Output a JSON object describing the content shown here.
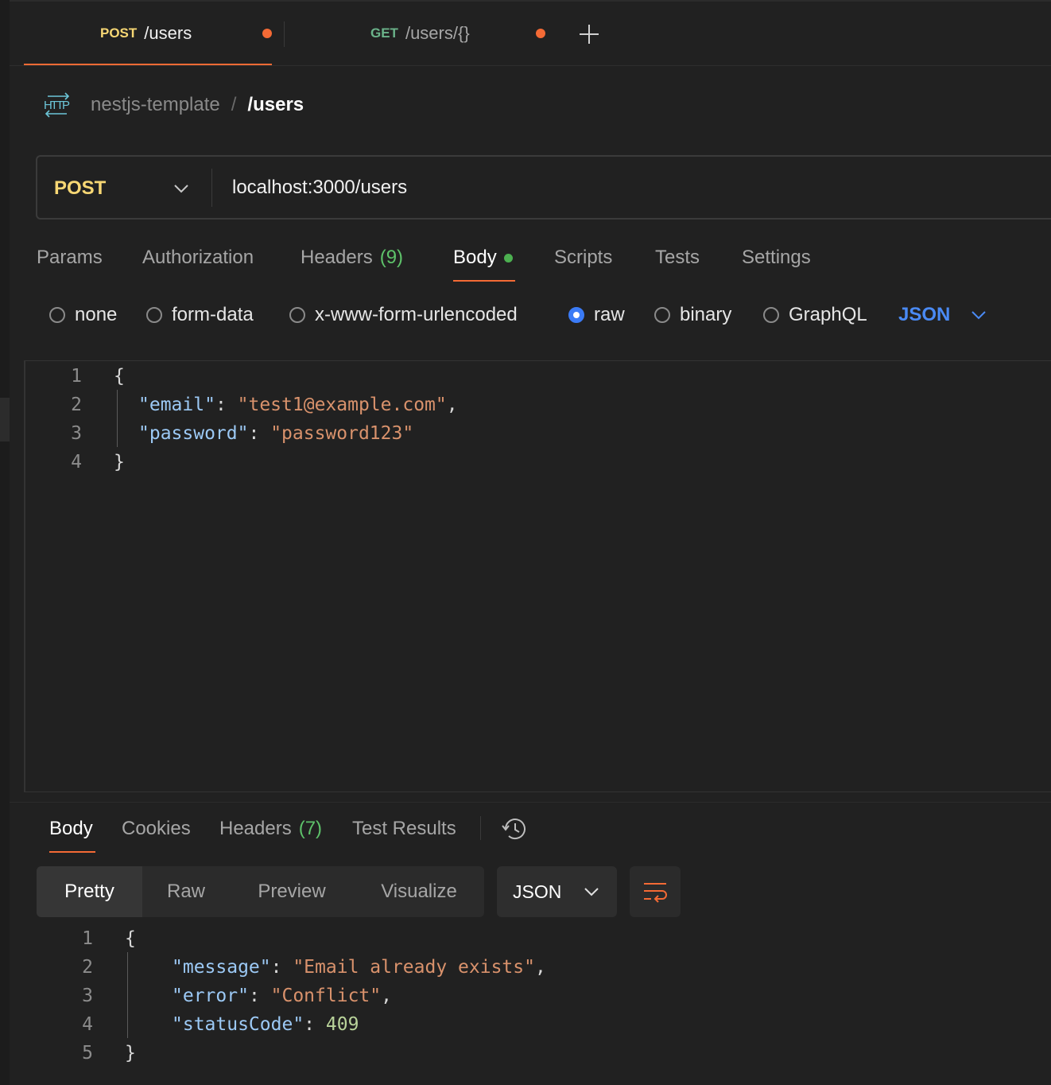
{
  "tabs": [
    {
      "method": "POST",
      "path": "/users",
      "method_color": "#f7d774",
      "unsaved": true,
      "active": true
    },
    {
      "method": "GET",
      "path": "/users/{}",
      "method_color": "#6bb38a",
      "unsaved": true,
      "active": false
    }
  ],
  "breadcrumb": {
    "collection": "nestjs-template",
    "separator": "/",
    "request": "/users"
  },
  "request": {
    "method": "POST",
    "url": "localhost:3000/users"
  },
  "request_tabs": {
    "params": "Params",
    "authorization": "Authorization",
    "headers": "Headers",
    "headers_count": "(9)",
    "body": "Body",
    "scripts": "Scripts",
    "tests": "Tests",
    "settings": "Settings"
  },
  "body_modes": {
    "none": "none",
    "form_data": "form-data",
    "urlencoded": "x-www-form-urlencoded",
    "raw": "raw",
    "binary": "binary",
    "graphql": "GraphQL",
    "selected": "raw",
    "language": "JSON"
  },
  "request_body": {
    "line_numbers": [
      "1",
      "2",
      "3",
      "4"
    ],
    "open_brace": "{",
    "close_brace": "}",
    "email_key": "\"email\"",
    "email_value": "\"test1@example.com\"",
    "password_key": "\"password\"",
    "password_value": "\"password123\""
  },
  "response_tabs": {
    "body": "Body",
    "cookies": "Cookies",
    "headers": "Headers",
    "headers_count": "(7)",
    "test_results": "Test Results"
  },
  "response_view": {
    "pretty": "Pretty",
    "raw": "Raw",
    "preview": "Preview",
    "visualize": "Visualize",
    "format": "JSON"
  },
  "response_body": {
    "line_numbers": [
      "1",
      "2",
      "3",
      "4",
      "5"
    ],
    "open_brace": "{",
    "close_brace": "}",
    "message_key": "\"message\"",
    "message_value": "\"Email already exists\"",
    "error_key": "\"error\"",
    "error_value": "\"Conflict\"",
    "status_key": "\"statusCode\"",
    "status_value": "409"
  },
  "colors": {
    "accent": "#f46a35",
    "post": "#f7d774",
    "get": "#6bb38a",
    "json_link": "#4a8af4",
    "radio_checked": "#3b7bf6"
  }
}
